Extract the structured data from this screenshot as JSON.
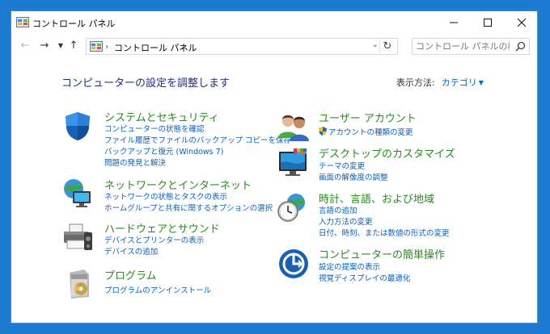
{
  "window": {
    "title": "コントロール パネル"
  },
  "address": {
    "breadcrumb": [
      "コントロール パネル"
    ],
    "search_placeholder": "コントロール パネルの検索"
  },
  "main": {
    "heading": "コンピューターの設定を調整します",
    "view_by_label": "表示方法:",
    "view_by_value": "カテゴリ"
  },
  "categories": [
    {
      "title": "システムとセキュリティ",
      "icon": "shield-icon",
      "links": [
        "コンピューターの状態を確認",
        "ファイル履歴でファイルのバックアップ コピーを保存",
        "バックアップと復元 (Windows 7)",
        "問題の発見と解決"
      ]
    },
    {
      "title": "ネットワークとインターネット",
      "icon": "network-globe-icon",
      "links": [
        "ネットワークの状態とタスクの表示",
        "ホームグループと共有に関するオプションの選択"
      ]
    },
    {
      "title": "ハードウェアとサウンド",
      "icon": "printer-icon",
      "links": [
        "デバイスとプリンターの表示",
        "デバイスの追加"
      ]
    },
    {
      "title": "プログラム",
      "icon": "programs-icon",
      "links": [
        "プログラムのアンインストール"
      ]
    },
    {
      "title": "ユーザー アカウント",
      "icon": "users-icon",
      "links": [
        "アカウントの種類の変更"
      ]
    },
    {
      "title": "デスクトップのカスタマイズ",
      "icon": "monitor-icon",
      "links": [
        "テーマの変更",
        "画面の解像度の調整"
      ]
    },
    {
      "title": "時計、言語、および地域",
      "icon": "clock-globe-icon",
      "links": [
        "言語の追加",
        "入力方法の変更",
        "日付、時刻、または数値の形式の変更"
      ]
    },
    {
      "title": "コンピューターの簡単操作",
      "icon": "ease-of-access-icon",
      "links": [
        "設定の提案の表示",
        "視覚ディスプレイの最適化"
      ]
    }
  ],
  "colors": {
    "desktop": "#1c7ad0",
    "category_title": "#2a8a20",
    "link": "#0b5fbe",
    "heading": "#1e3287"
  }
}
